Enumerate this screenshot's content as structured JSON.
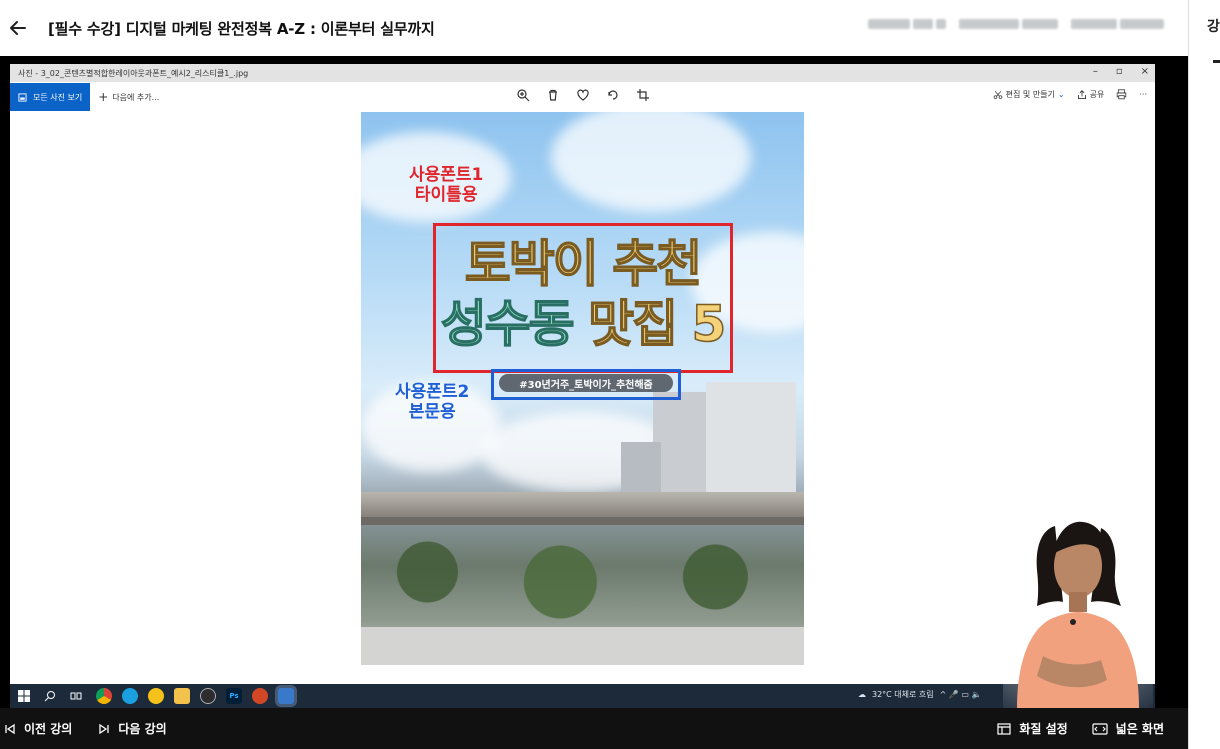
{
  "header": {
    "title": "[필수 수강] 디지털 마케팅 완전정복 A-Z : 이론부터 실무까지"
  },
  "side_panel": {
    "tab_char": "강"
  },
  "photos_app": {
    "window_title": "사진 - 3_02_콘텐츠별적합한레이아웃과폰트_예시2_리스티클1_.jpg",
    "window_controls": [
      "–",
      "▫",
      "×"
    ],
    "all_photos_label": "모든 사진 보기",
    "add_to_label": "다음에 추가...",
    "edit_label": "편집 및 만들기",
    "share_label": "공유",
    "more_label": "···"
  },
  "photo": {
    "red_label_line1": "사용폰트1",
    "red_label_line2": "타이틀용",
    "title_line1": "토박이 추천",
    "title_line2_part1": "성수동",
    "title_line2_part2": "맛집 5",
    "blue_label_line1": "사용폰트2",
    "blue_label_line2": "본문용",
    "hashtag": "#30년거주_토박이가_추천해줌"
  },
  "taskbar": {
    "weather": "32°C 대체로 흐림",
    "tray": "^ 🎤 ▭ 🔈"
  },
  "bottom": {
    "prev_label": "이전 강의",
    "next_label": "다음 강의",
    "quality_label": "화질 설정",
    "wide_label": "넓은 화면"
  },
  "colors": {
    "accent_blue": "#0b63c8",
    "label_red": "#e0262c",
    "label_blue": "#1f5fd6",
    "bottom_bar": "#111111"
  }
}
